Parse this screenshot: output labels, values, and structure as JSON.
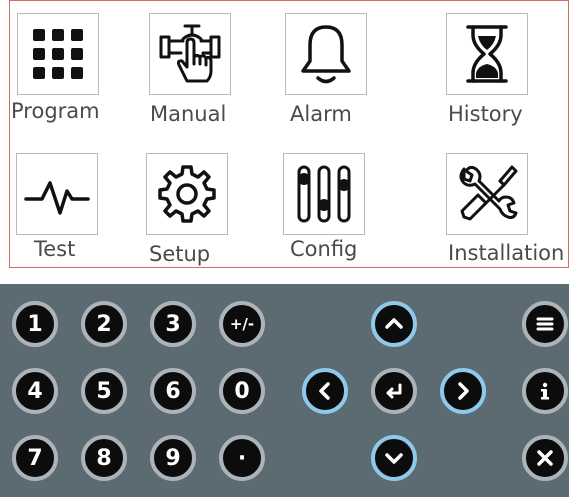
{
  "menu": {
    "items": [
      {
        "label": "Program",
        "icon": "grid-icon"
      },
      {
        "label": "Manual",
        "icon": "valve-hand-icon"
      },
      {
        "label": "Alarm",
        "icon": "bell-icon"
      },
      {
        "label": "History",
        "icon": "hourglass-icon"
      },
      {
        "label": "Test",
        "icon": "pulse-icon"
      },
      {
        "label": "Setup",
        "icon": "gear-icon"
      },
      {
        "label": "Config",
        "icon": "sliders-icon"
      },
      {
        "label": "Installation",
        "icon": "tools-icon"
      }
    ]
  },
  "keypad": {
    "digits": {
      "k1": "1",
      "k2": "2",
      "k3": "3",
      "plus_minus": "+/-",
      "k4": "4",
      "k5": "5",
      "k6": "6",
      "k0": "0",
      "k7": "7",
      "k8": "8",
      "k9": "9",
      "dot": "·"
    },
    "nav": [
      "up-arrow-icon",
      "left-arrow-icon",
      "enter-icon",
      "right-arrow-icon",
      "down-arrow-icon"
    ],
    "side": [
      "menu-icon",
      "info-icon",
      "close-icon"
    ],
    "colors": {
      "panel": "#5c6a72",
      "key_fill": "#0c0c0c",
      "key_ring": "#adb4b9",
      "nav_ring": "#8ec8ea",
      "menu_border": "#d96a6a"
    }
  }
}
